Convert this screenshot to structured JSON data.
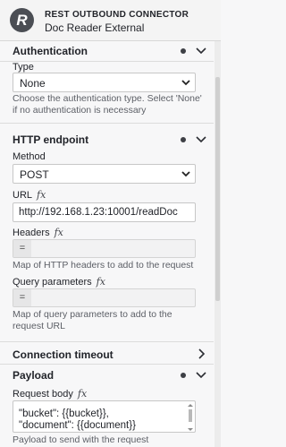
{
  "header": {
    "logo_letter": "R",
    "title": "REST OUTBOUND CONNECTOR",
    "subtitle": "Doc Reader External"
  },
  "authentication": {
    "heading": "Authentication",
    "type_label": "Type",
    "type_value": "None",
    "type_description": "Choose the authentication type. Select 'None' if no authentication is necessary"
  },
  "http_endpoint": {
    "heading": "HTTP endpoint",
    "method_label": "Method",
    "method_value": "POST",
    "url_label": "URL",
    "url_value": "http://192.168.1.23:10001/readDoc",
    "headers_label": "Headers",
    "headers_eq": "=",
    "headers_description": "Map of HTTP headers to add to the request",
    "query_label": "Query parameters",
    "query_eq": "=",
    "query_description": "Map of query parameters to add to the request URL"
  },
  "connection_timeout": {
    "heading": "Connection timeout"
  },
  "payload": {
    "heading": "Payload",
    "body_label": "Request body",
    "body_lines": [
      "`",
      "\"bucket\": {{bucket}},",
      "\"document\": {{document}}"
    ],
    "body_description": "Payload to send with the request"
  },
  "fx_symbol": "fx",
  "icons": {
    "section_dot": "dot-indicator-icon",
    "expand": "chevron-down-icon",
    "collapsed": "chevron-right-icon"
  }
}
